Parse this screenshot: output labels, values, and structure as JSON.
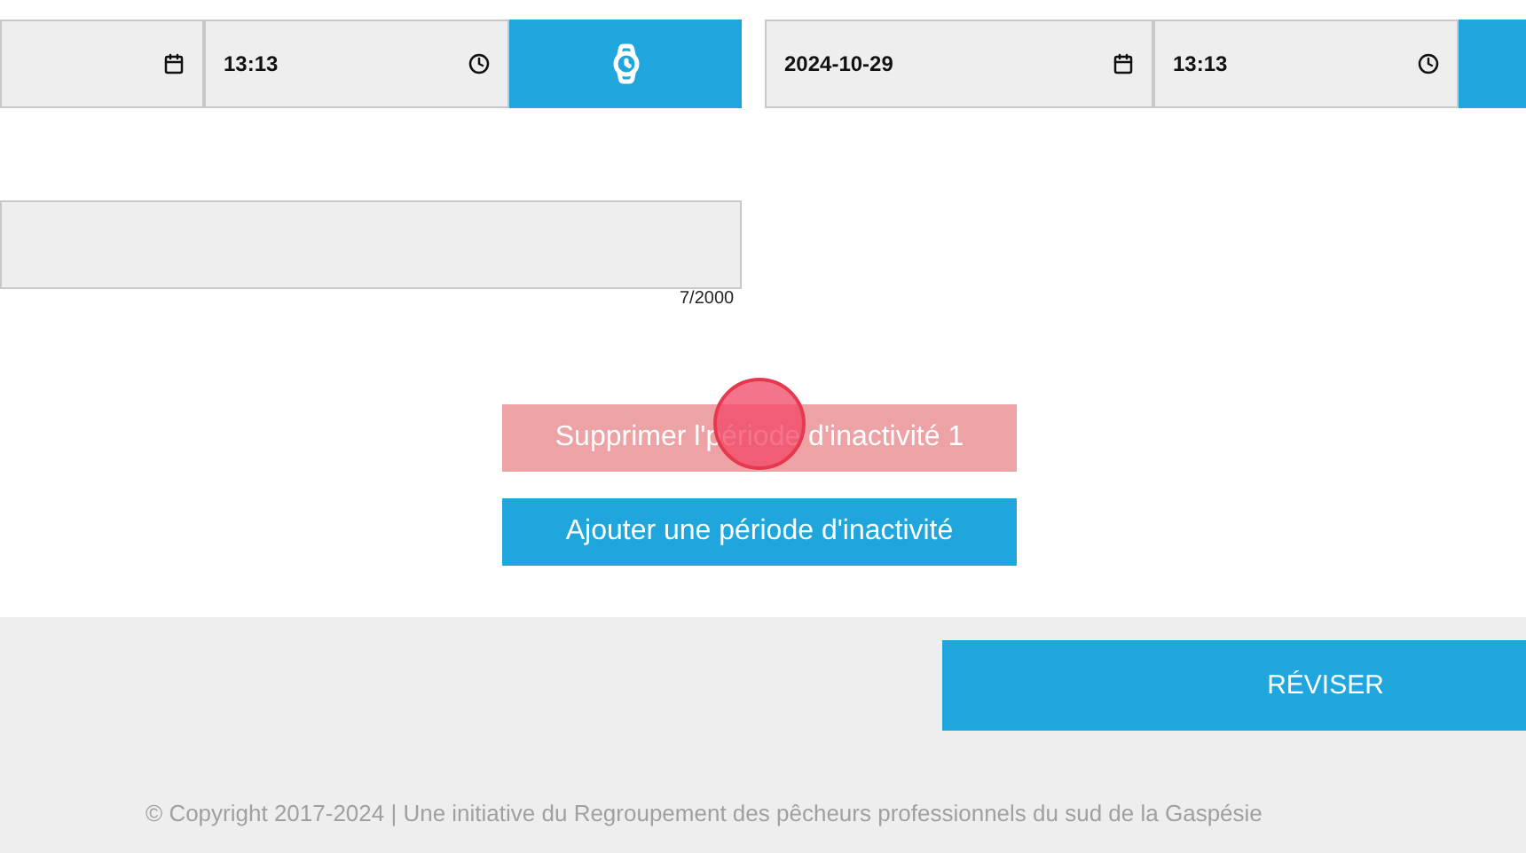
{
  "periods": [
    {
      "time": "13:13"
    },
    {
      "date": "2024-10-29",
      "time": "13:13"
    }
  ],
  "comment": {
    "counter": "7/2000"
  },
  "actions": [
    {
      "label": "Supprimer l'période d'inactivité 1",
      "kind": "danger"
    },
    {
      "label": "Ajouter une période d'inactivité",
      "kind": "primary"
    }
  ],
  "review_button": "RÉVISER",
  "footer": "© Copyright 2017-2024 | Une initiative du Regroupement des pêcheurs professionnels du sud de la Gaspésie"
}
